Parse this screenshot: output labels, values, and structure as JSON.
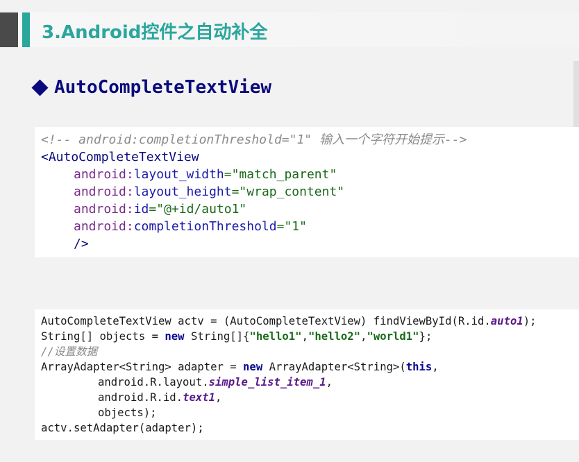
{
  "slide": {
    "title": "3.Android控件之自动补全",
    "section_heading": "AutoCompleteTextView"
  },
  "xml_code": {
    "comment": "<!-- android:completionThreshold=\"1\" 输入一个字符开始提示-->",
    "open_tag": "<AutoCompleteTextView",
    "attrs": [
      {
        "ns": "android:",
        "name": "layout_width",
        "value": "=\"match_parent\""
      },
      {
        "ns": "android:",
        "name": "layout_height",
        "value": "=\"wrap_content\""
      },
      {
        "ns": "android:",
        "name": "id",
        "value": "=\"@+id/auto1\""
      },
      {
        "ns": "android:",
        "name": "completionThreshold",
        "value": "=\"1\""
      }
    ],
    "close_tag": "/>"
  },
  "java_code": {
    "line1_a": "AutoCompleteTextView actv = (AutoCompleteTextView) findViewById(R.id.",
    "line1_field": "auto1",
    "line1_end": ");",
    "line2_a": "String[] objects = ",
    "line2_kw": "new",
    "line2_b": " String[]{",
    "line2_s1": "\"hello1\"",
    "line2_s2": "\"hello2\"",
    "line2_s3": "\"world1\"",
    "line2_end": "};",
    "comma": ",",
    "line3_comment": "//设置数据",
    "line4_a": "ArrayAdapter<String> adapter = ",
    "line4_kw": "new",
    "line4_b": " ArrayAdapter<String>(",
    "line4_this": "this",
    "line4_end": ",",
    "line5_a": "android.R.layout.",
    "line5_field": "simple_list_item_1",
    "line5_end": ",",
    "line6_a": "android.R.id.",
    "line6_field": "text1",
    "line6_end": ",",
    "line7": "objects);",
    "line8": "actv.setAdapter(adapter);"
  }
}
